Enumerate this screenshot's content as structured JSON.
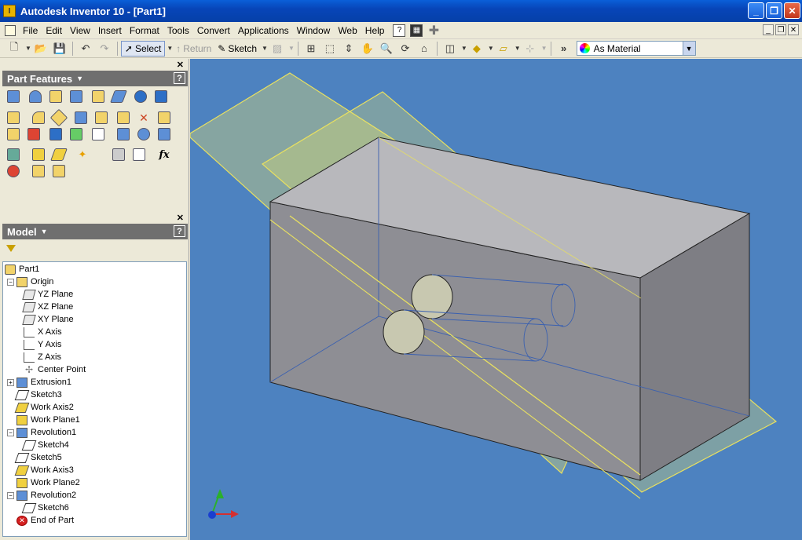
{
  "window": {
    "title": "Autodesk Inventor 10 - [Part1]",
    "minimize": "_",
    "restore": "❐",
    "close": "✕"
  },
  "menu": [
    "File",
    "Edit",
    "View",
    "Insert",
    "Format",
    "Tools",
    "Convert",
    "Applications",
    "Window",
    "Web",
    "Help"
  ],
  "toolbar": {
    "select_label": "Select",
    "return_label": "Return",
    "sketch_label": "Sketch",
    "material_value": "As Material"
  },
  "part_features": {
    "title": "Part Features"
  },
  "model_panel": {
    "title": "Model",
    "tree": [
      {
        "label": "Part1",
        "icon": "part",
        "level": 0
      },
      {
        "label": "Origin",
        "icon": "folder",
        "level": 1,
        "expander": "−"
      },
      {
        "label": "YZ Plane",
        "icon": "plane",
        "level": 2
      },
      {
        "label": "XZ Plane",
        "icon": "plane",
        "level": 2
      },
      {
        "label": "XY Plane",
        "icon": "plane",
        "level": 2
      },
      {
        "label": "X Axis",
        "icon": "axis",
        "level": 2
      },
      {
        "label": "Y Axis",
        "icon": "axis",
        "level": 2
      },
      {
        "label": "Z Axis",
        "icon": "axis",
        "level": 2
      },
      {
        "label": "Center Point",
        "icon": "point",
        "level": 2
      },
      {
        "label": "Extrusion1",
        "icon": "feature",
        "level": 1,
        "expander": "+"
      },
      {
        "label": "Sketch3",
        "icon": "sketch",
        "level": 1
      },
      {
        "label": "Work Axis2",
        "icon": "workaxis",
        "level": 1
      },
      {
        "label": "Work Plane1",
        "icon": "workplane",
        "level": 1
      },
      {
        "label": "Revolution1",
        "icon": "feature",
        "level": 1,
        "expander": "−"
      },
      {
        "label": "Sketch4",
        "icon": "sketch",
        "level": 2
      },
      {
        "label": "Sketch5",
        "icon": "sketch",
        "level": 1
      },
      {
        "label": "Work Axis3",
        "icon": "workaxis",
        "level": 1
      },
      {
        "label": "Work Plane2",
        "icon": "workplane",
        "level": 1
      },
      {
        "label": "Revolution2",
        "icon": "feature",
        "level": 1,
        "expander": "−"
      },
      {
        "label": "Sketch6",
        "icon": "sketch",
        "level": 2
      },
      {
        "label": "End of Part",
        "icon": "end",
        "level": 1
      }
    ]
  },
  "colors": {
    "viewport_bg": "#4d82c0",
    "title_bar": "#0a5fd8",
    "work_plane": "#f0e868"
  }
}
